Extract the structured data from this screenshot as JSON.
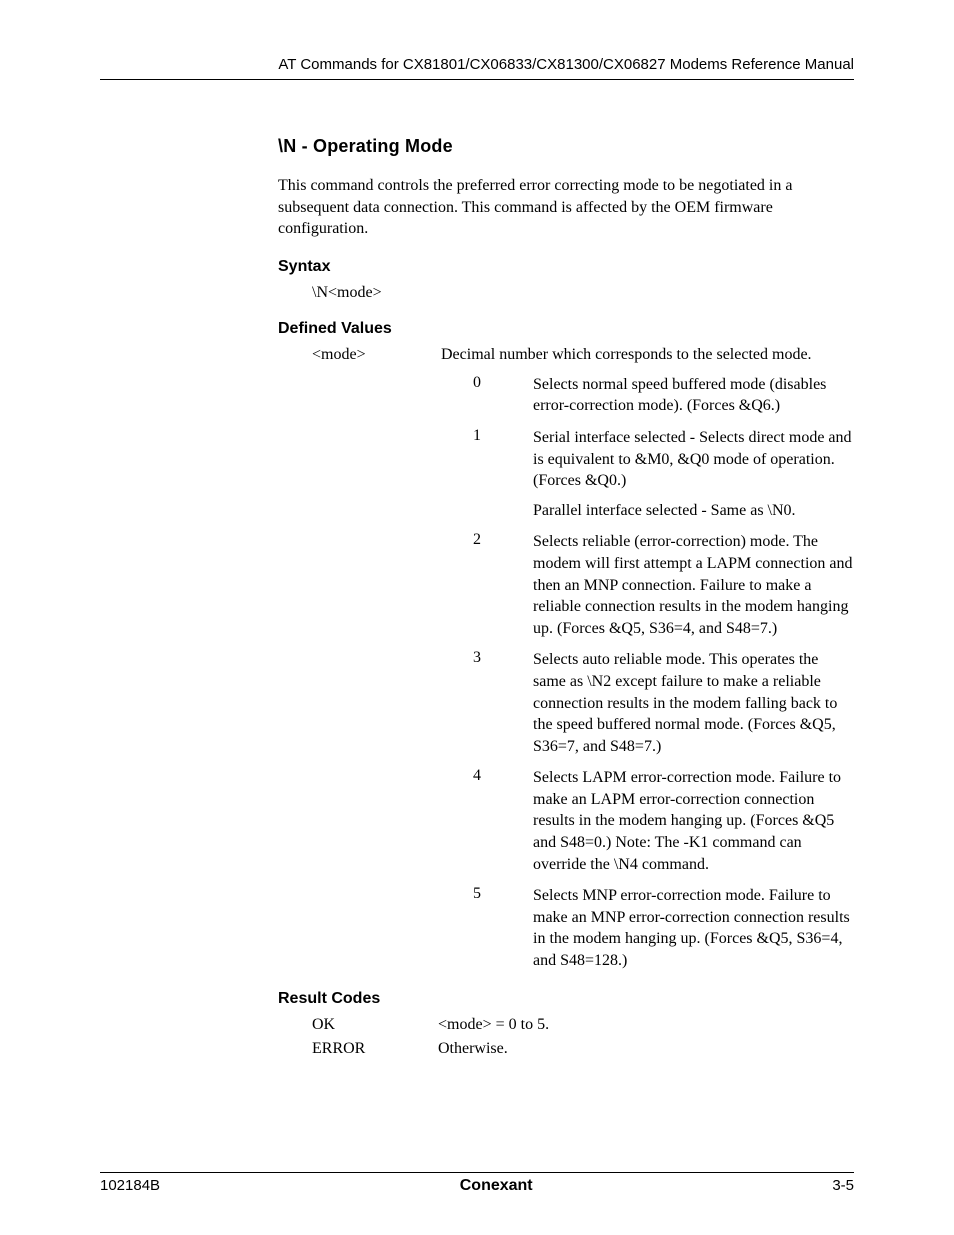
{
  "header": {
    "running_head": "AT Commands for CX81801/CX06833/CX81300/CX06827 Modems Reference Manual"
  },
  "section": {
    "title": "\\N - Operating Mode",
    "intro": "This command controls the preferred error correcting mode to be negotiated in a subsequent data connection. This command is affected by the OEM firmware configuration.",
    "syntax_heading": "Syntax",
    "syntax_text": "\\N<mode>",
    "defined_values_heading": "Defined Values",
    "param_name": "<mode>",
    "param_desc": "Decimal number which corresponds to the selected mode.",
    "values": [
      {
        "key": "0",
        "text": "Selects normal speed buffered mode (disables error-correction mode). (Forces &Q6.)"
      },
      {
        "key": "1",
        "text": "Serial interface selected - Selects direct mode and is equivalent to &M0, &Q0 mode of operation. (Forces &Q0.)",
        "extra": "Parallel interface selected - Same as \\N0."
      },
      {
        "key": "2",
        "text": "Selects reliable (error-correction) mode. The modem will first attempt a LAPM connection and then an MNP connection. Failure to make a reliable connection results in the modem hanging up. (Forces &Q5, S36=4, and S48=7.)"
      },
      {
        "key": "3",
        "text": "Selects auto reliable mode. This operates the same as \\N2 except failure to make a reliable connection results in the modem falling back to the speed buffered normal mode. (Forces &Q5, S36=7, and S48=7.)"
      },
      {
        "key": "4",
        "text": "Selects LAPM error-correction mode. Failure to make an LAPM error-correction connection results in the modem hanging up. (Forces &Q5 and S48=0.) Note: The -K1 command can override the \\N4 command."
      },
      {
        "key": "5",
        "text": "Selects MNP error-correction mode. Failure to make an MNP error-correction connection results in the modem hanging up. (Forces &Q5, S36=4, and S48=128.)"
      }
    ],
    "result_codes_heading": "Result Codes",
    "result_codes": [
      {
        "key": "OK",
        "text": "<mode> = 0 to 5."
      },
      {
        "key": "ERROR",
        "text": "Otherwise."
      }
    ]
  },
  "footer": {
    "left": "102184B",
    "center": "Conexant",
    "right": "3-5"
  }
}
